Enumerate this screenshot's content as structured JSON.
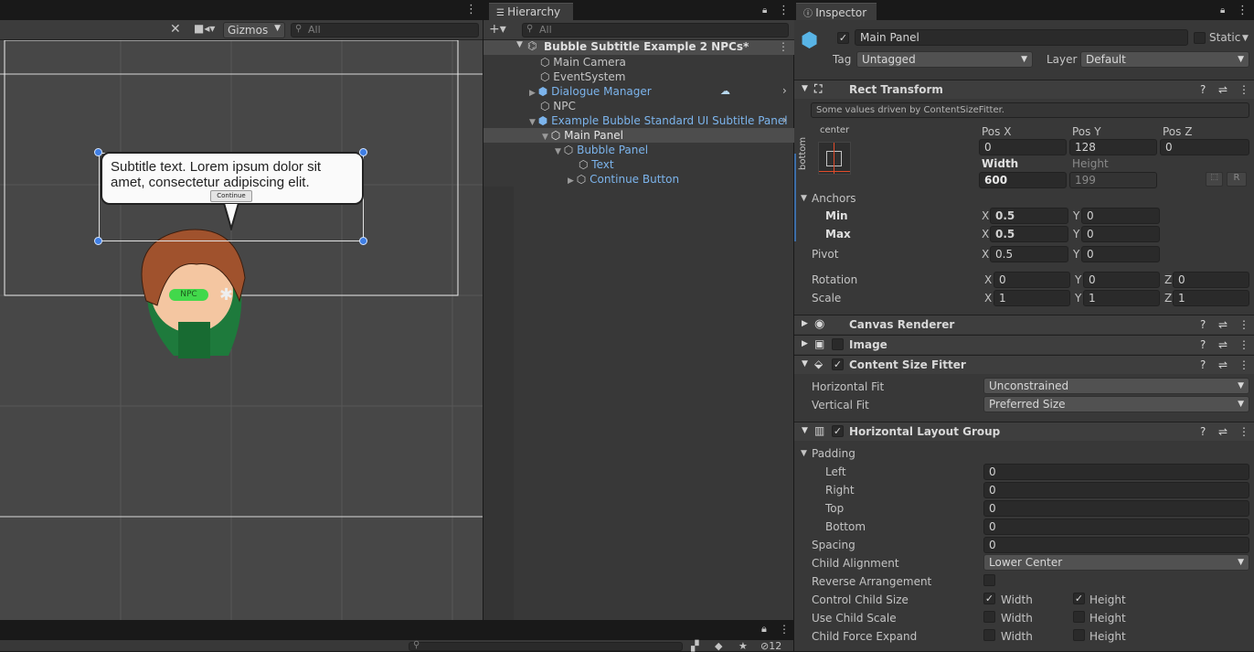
{
  "scene": {
    "gizmos_label": "Gizmos",
    "search_placeholder": "All",
    "bubble_text": "Subtitle text. Lorem ipsum dolor sit amet, consectetur adipiscing elit.",
    "continue_label": "Continue",
    "npc_label": "NPC"
  },
  "hierarchy": {
    "tab_label": "Hierarchy",
    "search_placeholder": "All",
    "root": "Bubble Subtitle Example 2 NPCs*",
    "items": [
      "Main Camera",
      "EventSystem",
      "Dialogue Manager",
      "NPC",
      "Example Bubble Standard UI Subtitle Panel",
      "Main Panel",
      "Bubble Panel",
      "Text",
      "Continue Button"
    ]
  },
  "bottom": {
    "count": "12"
  },
  "inspector": {
    "tab_label": "Inspector",
    "object_name": "Main Panel",
    "static_label": "Static",
    "tag_label": "Tag",
    "tag_value": "Untagged",
    "layer_label": "Layer",
    "layer_value": "Default",
    "rect": {
      "title": "Rect Transform",
      "note": "Some values driven by ContentSizeFitter.",
      "anchor_h": "center",
      "anchor_v": "bottom",
      "pos_x_label": "Pos X",
      "pos_y_label": "Pos Y",
      "pos_z_label": "Pos Z",
      "pos_x": "0",
      "pos_y": "128",
      "pos_z": "0",
      "width_label": "Width",
      "height_label": "Height",
      "width": "600",
      "height": "199",
      "r_label": "R",
      "anchors_label": "Anchors",
      "min_label": "Min",
      "max_label": "Max",
      "min_x": "0.5",
      "min_y": "0",
      "max_x": "0.5",
      "max_y": "0",
      "pivot_label": "Pivot",
      "pivot_x": "0.5",
      "pivot_y": "0",
      "rotation_label": "Rotation",
      "rot_x": "0",
      "rot_y": "0",
      "rot_z": "0",
      "scale_label": "Scale",
      "scale_x": "1",
      "scale_y": "1",
      "scale_z": "1",
      "x": "X",
      "y": "Y",
      "z": "Z"
    },
    "canvas_renderer": "Canvas Renderer",
    "image": "Image",
    "csf": {
      "title": "Content Size Fitter",
      "h_label": "Horizontal Fit",
      "h_value": "Unconstrained",
      "v_label": "Vertical Fit",
      "v_value": "Preferred Size"
    },
    "hlg": {
      "title": "Horizontal Layout Group",
      "padding": "Padding",
      "left": "Left",
      "right": "Right",
      "top": "Top",
      "bottom": "Bottom",
      "left_v": "0",
      "right_v": "0",
      "top_v": "0",
      "bottom_v": "0",
      "spacing": "Spacing",
      "spacing_v": "0",
      "child_alignment": "Child Alignment",
      "child_alignment_v": "Lower Center",
      "reverse": "Reverse Arrangement",
      "control_size": "Control Child Size",
      "use_scale": "Use Child Scale",
      "force_expand": "Child Force Expand",
      "width": "Width",
      "height": "Height"
    }
  },
  "check": "✓"
}
